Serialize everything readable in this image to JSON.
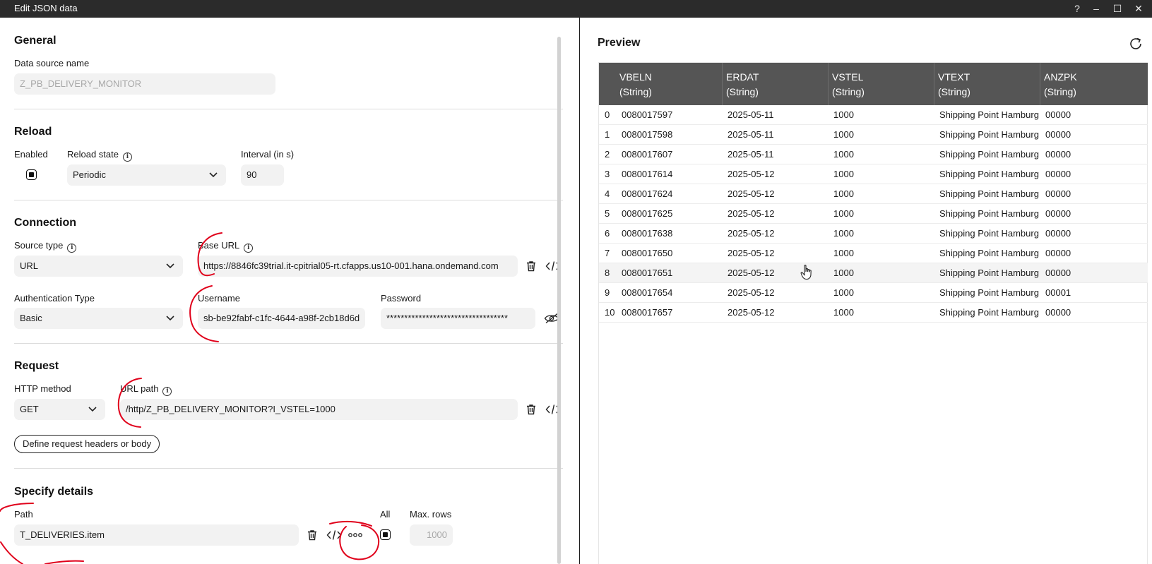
{
  "window": {
    "title": "Edit JSON data",
    "help_glyph": "?",
    "minimize_glyph": "–",
    "maximize_glyph": "☐",
    "close_glyph": "✕"
  },
  "general": {
    "title": "General",
    "data_source_name_label": "Data source name",
    "data_source_name_value": "Z_PB_DELIVERY_MONITOR"
  },
  "reload": {
    "title": "Reload",
    "enabled_label": "Enabled",
    "enabled_checked": true,
    "reload_state_label": "Reload state",
    "reload_state_value": "Periodic",
    "interval_label": "Interval (in s)",
    "interval_value": "90"
  },
  "connection": {
    "title": "Connection",
    "source_type_label": "Source type",
    "source_type_value": "URL",
    "base_url_label": "Base URL",
    "base_url_value": "https://8846fc39trial.it-cpitrial05-rt.cfapps.us10-001.hana.ondemand.com",
    "auth_type_label": "Authentication Type",
    "auth_type_value": "Basic",
    "username_label": "Username",
    "username_value": "sb-be92fabf-c1fc-4644-a98f-2cb18d6d",
    "password_label": "Password",
    "password_value": "**********************************"
  },
  "request": {
    "title": "Request",
    "http_method_label": "HTTP method",
    "http_method_value": "GET",
    "url_path_label": "URL path",
    "url_path_value": "/http/Z_PB_DELIVERY_MONITOR?I_VSTEL=1000",
    "define_headers_button": "Define request headers or body"
  },
  "details": {
    "title": "Specify details",
    "path_label": "Path",
    "path_value": "T_DELIVERIES.item",
    "all_label": "All",
    "all_checked": true,
    "max_rows_label": "Max. rows",
    "max_rows_value": "1000",
    "more_glyph": "ooo"
  },
  "preview": {
    "title": "Preview",
    "columns": [
      {
        "name": "VBELN",
        "type": "(String)"
      },
      {
        "name": "ERDAT",
        "type": "(String)"
      },
      {
        "name": "VSTEL",
        "type": "(String)"
      },
      {
        "name": "VTEXT",
        "type": "(String)"
      },
      {
        "name": "ANZPK",
        "type": "(String)"
      }
    ],
    "rows": [
      {
        "idx": "0",
        "cells": [
          "0080017597",
          "2025-05-11",
          "1000",
          "Shipping Point Hamburg",
          "00000"
        ]
      },
      {
        "idx": "1",
        "cells": [
          "0080017598",
          "2025-05-11",
          "1000",
          "Shipping Point Hamburg",
          "00000"
        ]
      },
      {
        "idx": "2",
        "cells": [
          "0080017607",
          "2025-05-11",
          "1000",
          "Shipping Point Hamburg",
          "00000"
        ]
      },
      {
        "idx": "3",
        "cells": [
          "0080017614",
          "2025-05-12",
          "1000",
          "Shipping Point Hamburg",
          "00000"
        ]
      },
      {
        "idx": "4",
        "cells": [
          "0080017624",
          "2025-05-12",
          "1000",
          "Shipping Point Hamburg",
          "00000"
        ]
      },
      {
        "idx": "5",
        "cells": [
          "0080017625",
          "2025-05-12",
          "1000",
          "Shipping Point Hamburg",
          "00000"
        ]
      },
      {
        "idx": "6",
        "cells": [
          "0080017638",
          "2025-05-12",
          "1000",
          "Shipping Point Hamburg",
          "00000"
        ]
      },
      {
        "idx": "7",
        "cells": [
          "0080017650",
          "2025-05-12",
          "1000",
          "Shipping Point Hamburg",
          "00000"
        ]
      },
      {
        "idx": "8",
        "cells": [
          "0080017651",
          "2025-05-12",
          "1000",
          "Shipping Point Hamburg",
          "00000"
        ]
      },
      {
        "idx": "9",
        "cells": [
          "0080017654",
          "2025-05-12",
          "1000",
          "Shipping Point Hamburg",
          "00001"
        ]
      },
      {
        "idx": "10",
        "cells": [
          "0080017657",
          "2025-05-12",
          "1000",
          "Shipping Point Hamburg",
          "00000"
        ]
      }
    ],
    "hovered_row_index": 8
  },
  "icons": [
    "info-icon",
    "chevron-down-icon",
    "trash-icon",
    "code-icon",
    "eye-slash-icon",
    "refresh-icon",
    "more-icon",
    "hand-cursor-icon"
  ],
  "colors": {
    "titlebar": "#2b2b2b",
    "table_header": "#555555",
    "field_bg": "#f2f2f2",
    "annotation": "#e0001b"
  }
}
